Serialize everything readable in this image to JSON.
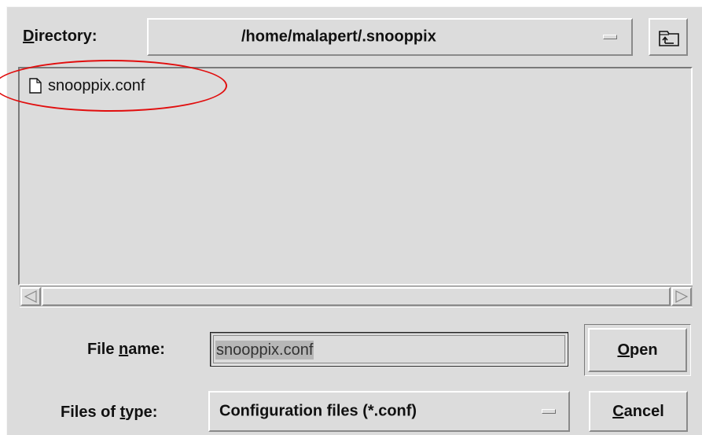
{
  "directory": {
    "label_pre": "",
    "label_mnemonic": "D",
    "label_post": "irectory:",
    "current_path": "/home/malapert/.snooppix"
  },
  "up_directory_icon": "folder-up-icon",
  "file_list": {
    "items": [
      {
        "name": "snooppix.conf",
        "icon": "document-icon",
        "highlighted": true
      }
    ]
  },
  "file_name": {
    "label_pre": "File ",
    "label_mnemonic": "n",
    "label_post": "ame:",
    "value": "snooppix.conf"
  },
  "file_type": {
    "label_pre": "Files of ",
    "label_mnemonic": "t",
    "label_post": "ype:",
    "selected": "Configuration files (*.conf)"
  },
  "buttons": {
    "open_mnemonic": "O",
    "open_rest": "pen",
    "cancel_mnemonic": "C",
    "cancel_rest": "ancel"
  },
  "colors": {
    "background": "#dcdcdc",
    "highlight_ring": "#e10e0e"
  }
}
